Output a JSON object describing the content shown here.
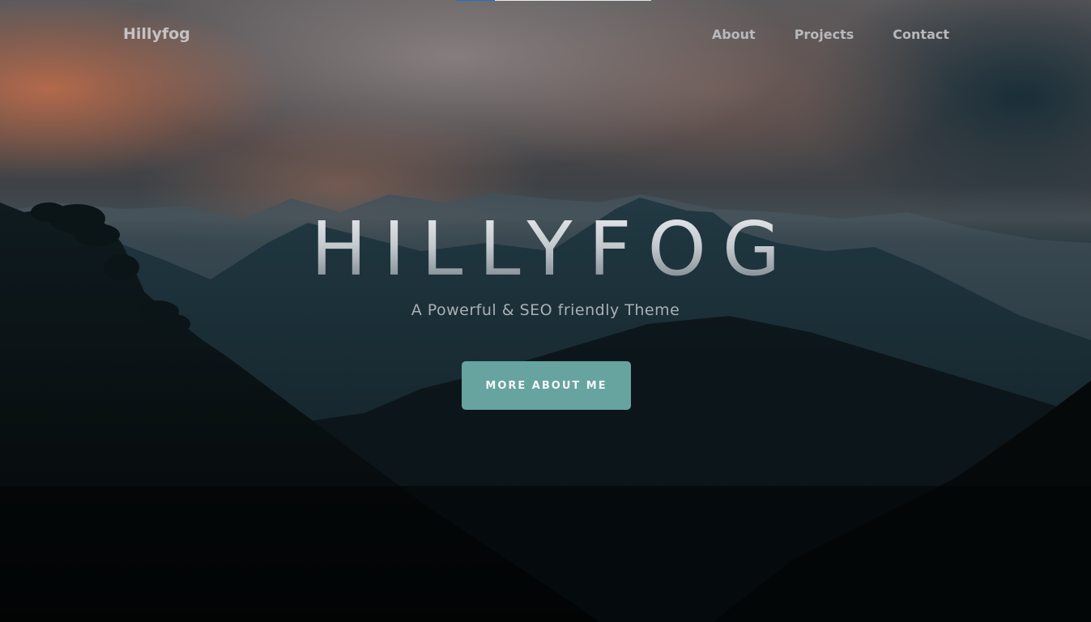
{
  "header": {
    "brand": "Hillyfog",
    "nav": [
      {
        "label": "About"
      },
      {
        "label": "Projects"
      },
      {
        "label": "Contact"
      }
    ]
  },
  "scroll_progress": {
    "fraction": 0.2,
    "fill_color": "#1e6fd6"
  },
  "hero": {
    "title": "HILLYFOG",
    "subtitle": "A Powerful & SEO friendly Theme",
    "cta_label": "MORE ABOUT ME",
    "cta_color": "#67a39f",
    "background": "misty-mountains-photo"
  }
}
